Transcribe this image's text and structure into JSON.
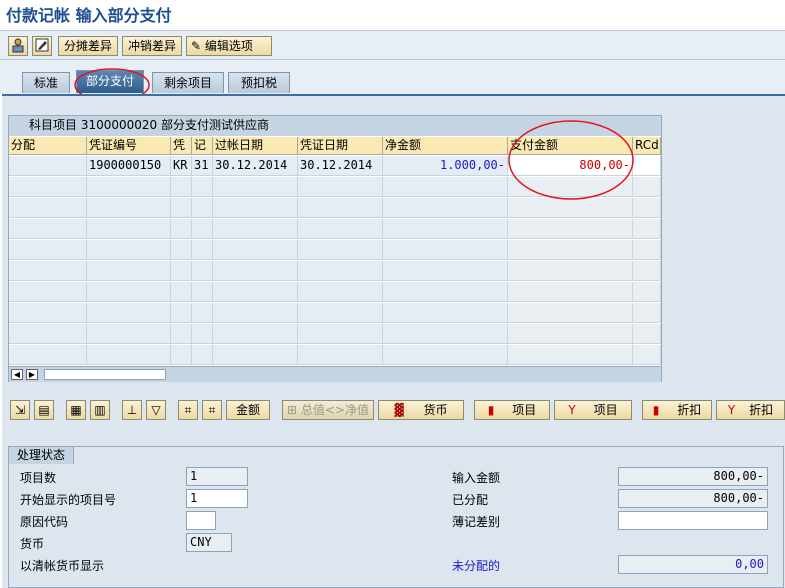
{
  "window": {
    "title": "付款记帐 输入部分支付"
  },
  "toolbar": {
    "btn_split_diff": "分摊差异",
    "btn_reverse_diff": "冲销差异",
    "btn_edit_options": "编辑选项"
  },
  "tabs": [
    {
      "label": "标准"
    },
    {
      "label": "部分支付"
    },
    {
      "label": "剩余项目"
    },
    {
      "label": "预扣税"
    }
  ],
  "grid": {
    "title": "科目项目 3100000020 部分支付测试供应商",
    "columns": [
      "分配",
      "凭证编号",
      "凭",
      "记",
      "过帐日期",
      "凭证日期",
      "净金额",
      "支付金额",
      "RCd"
    ],
    "rows": [
      {
        "assign": "",
        "docno": "1900000150",
        "type": "KR",
        "pk": "31",
        "post_date": "30.12.2014",
        "doc_date": "30.12.2014",
        "net": "1.000,00-",
        "pay": "800,00-",
        "rcd": ""
      }
    ]
  },
  "actions": {
    "amount": "金额",
    "gross_net": "总值<>净值",
    "currency": "货币",
    "items1": "项目",
    "items2": "项目",
    "discount1": "折扣",
    "discount2": "折扣"
  },
  "status": {
    "title": "处理状态",
    "item_count_label": "项目数",
    "item_count_value": "1",
    "first_item_label": "开始显示的项目号",
    "first_item_value": "1",
    "reason_code_label": "原因代码",
    "reason_code_value": "",
    "currency_label": "货币",
    "currency_value": "CNY",
    "clearing_currency_label": "以清帐货币显示",
    "entered_amount_label": "输入金额",
    "entered_amount_value": "800,00-",
    "assigned_label": "已分配",
    "assigned_value": "800,00-",
    "posting_diff_label": "薄记差别",
    "posting_diff_value": "",
    "not_assigned_label": "未分配的",
    "not_assigned_value": "0,00"
  },
  "colors": {
    "amount_blue": "#1a1acc",
    "amount_red": "#cc0000",
    "annotation_red": "#e0141e"
  }
}
